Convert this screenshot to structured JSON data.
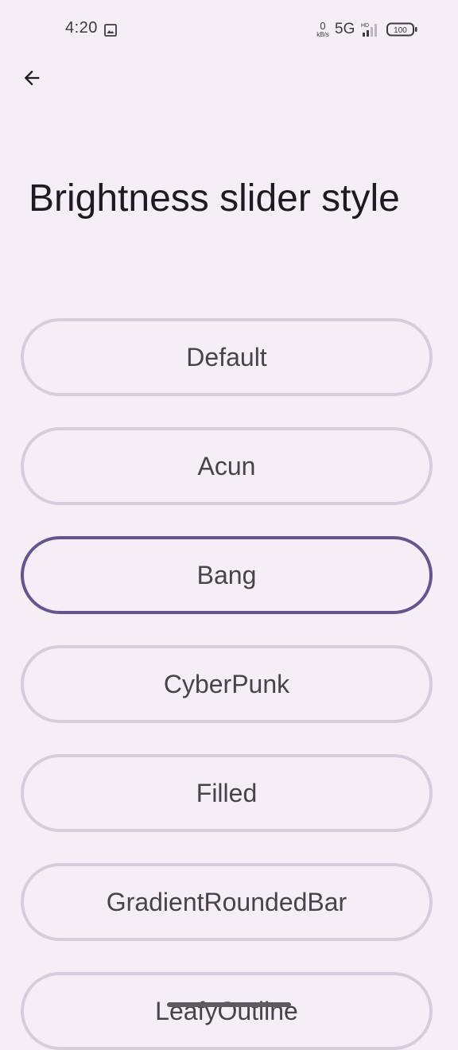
{
  "status_bar": {
    "time": "4:20",
    "net_speed_value": "0",
    "net_speed_unit": "kB/s",
    "network_type": "5G",
    "signal_label": "HD",
    "battery_level": "100",
    "icons": [
      "gallery-icon",
      "signal-icon",
      "battery-icon"
    ]
  },
  "app_bar": {
    "back_icon": "arrow-back-icon"
  },
  "page": {
    "title": "Brightness slider style"
  },
  "options": [
    {
      "label": "Default",
      "selected": false
    },
    {
      "label": "Acun",
      "selected": false
    },
    {
      "label": "Bang",
      "selected": true
    },
    {
      "label": "CyberPunk",
      "selected": false
    },
    {
      "label": "Filled",
      "selected": false
    },
    {
      "label": "GradientRoundedBar",
      "selected": false
    },
    {
      "label": "LeafyOutline",
      "selected": false
    }
  ],
  "colors": {
    "background": "#f4eef7",
    "option_border": "#d5cddc",
    "selected_border": "#65558f",
    "option_text": "#46434a"
  }
}
